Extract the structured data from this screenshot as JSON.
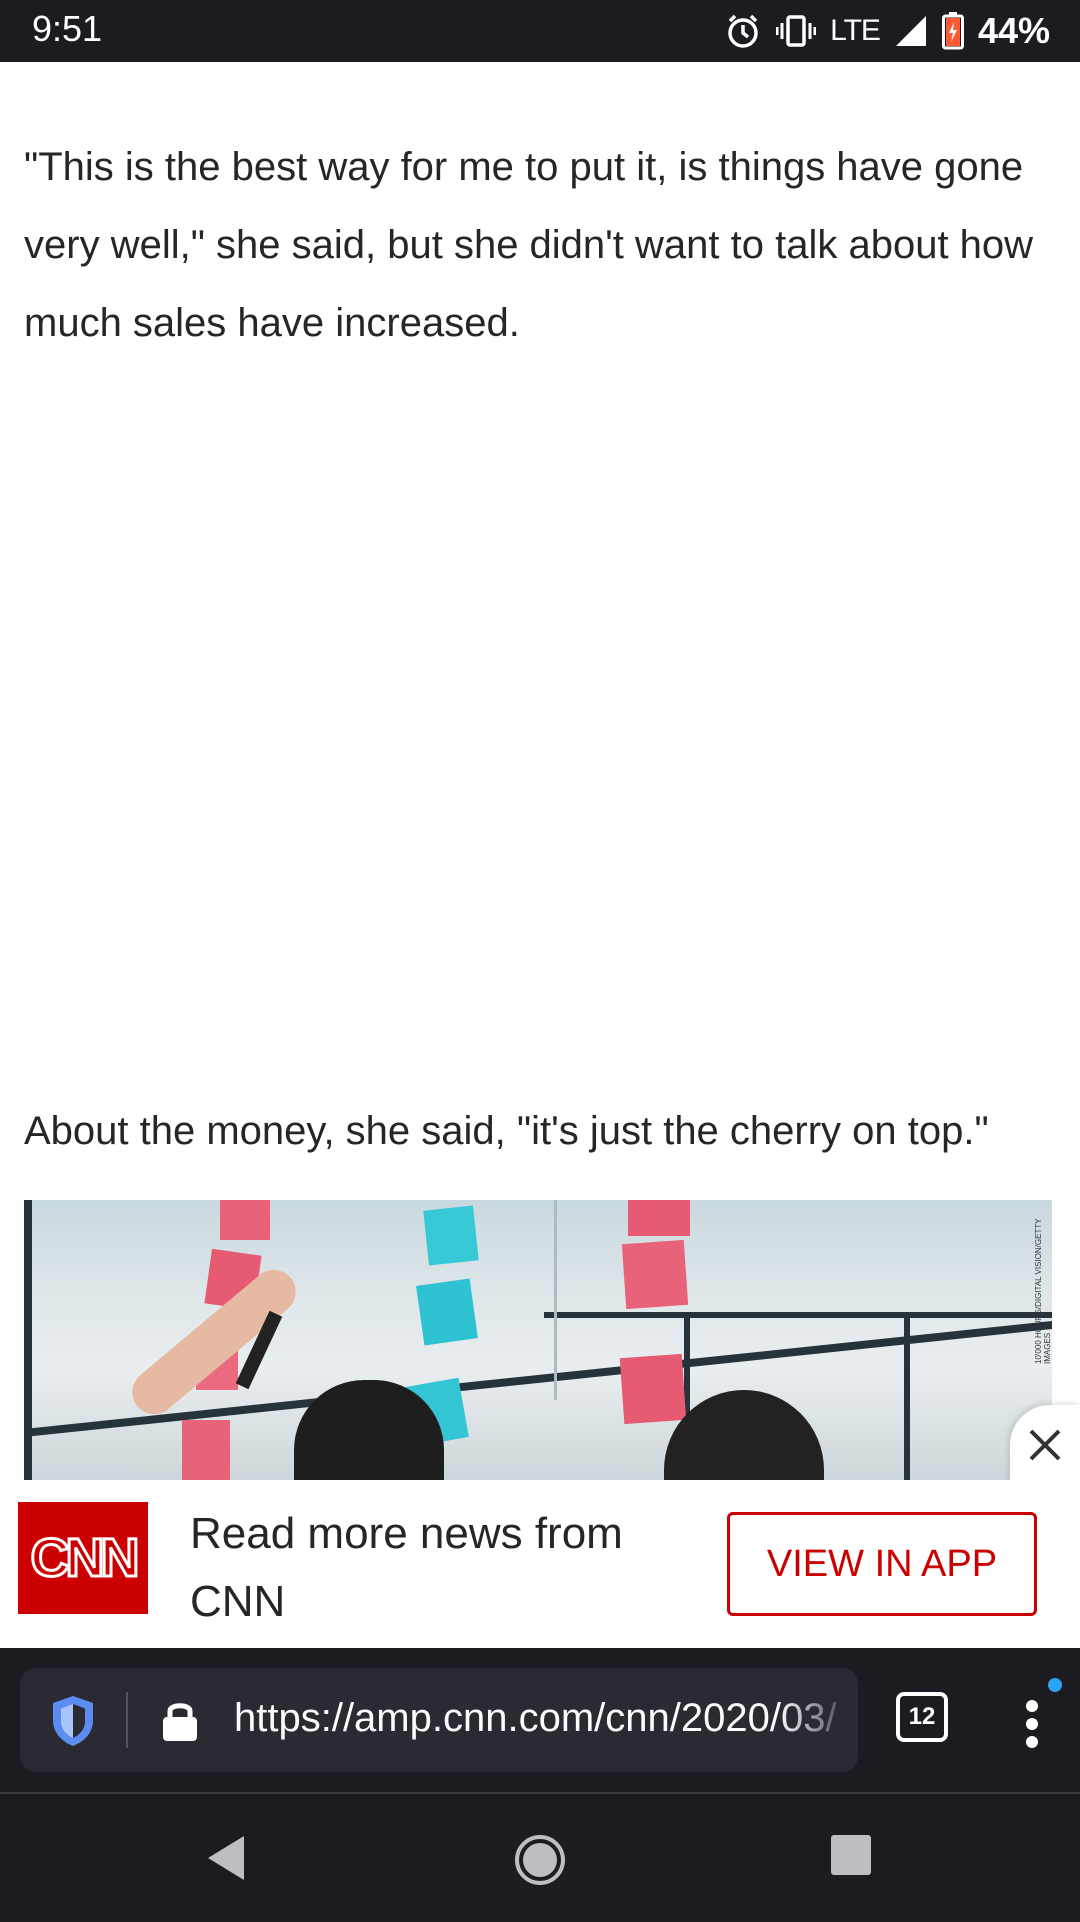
{
  "status_bar": {
    "time": "9:51",
    "network": "LTE",
    "battery": "44%",
    "icons": [
      "alarm-icon",
      "vibrate-icon",
      "signal-icon",
      "battery-icon"
    ]
  },
  "article": {
    "paragraph1": "\"This is the best way for me to put it, is things have gone very well,\" she said, but she didn't want to talk about how much sales have increased.",
    "paragraph2": "About the money, she said, \"it's just the cherry on top.\""
  },
  "photo": {
    "credit": "10'000 HOURS/DIGITAL VISION/GETTY IMAGES"
  },
  "app_banner": {
    "logo_text": "CNN",
    "message": "Read more news from CNN",
    "button_label": "VIEW IN APP",
    "brand_color": "#cc0000"
  },
  "browser_toolbar": {
    "url": "https://amp.cnn.com/cnn/2020/03/",
    "tab_count": "12"
  },
  "colors": {
    "system_bar": "#1c1b22",
    "url_field": "#2b2a33",
    "notification_dot": "#2aa4f4"
  }
}
